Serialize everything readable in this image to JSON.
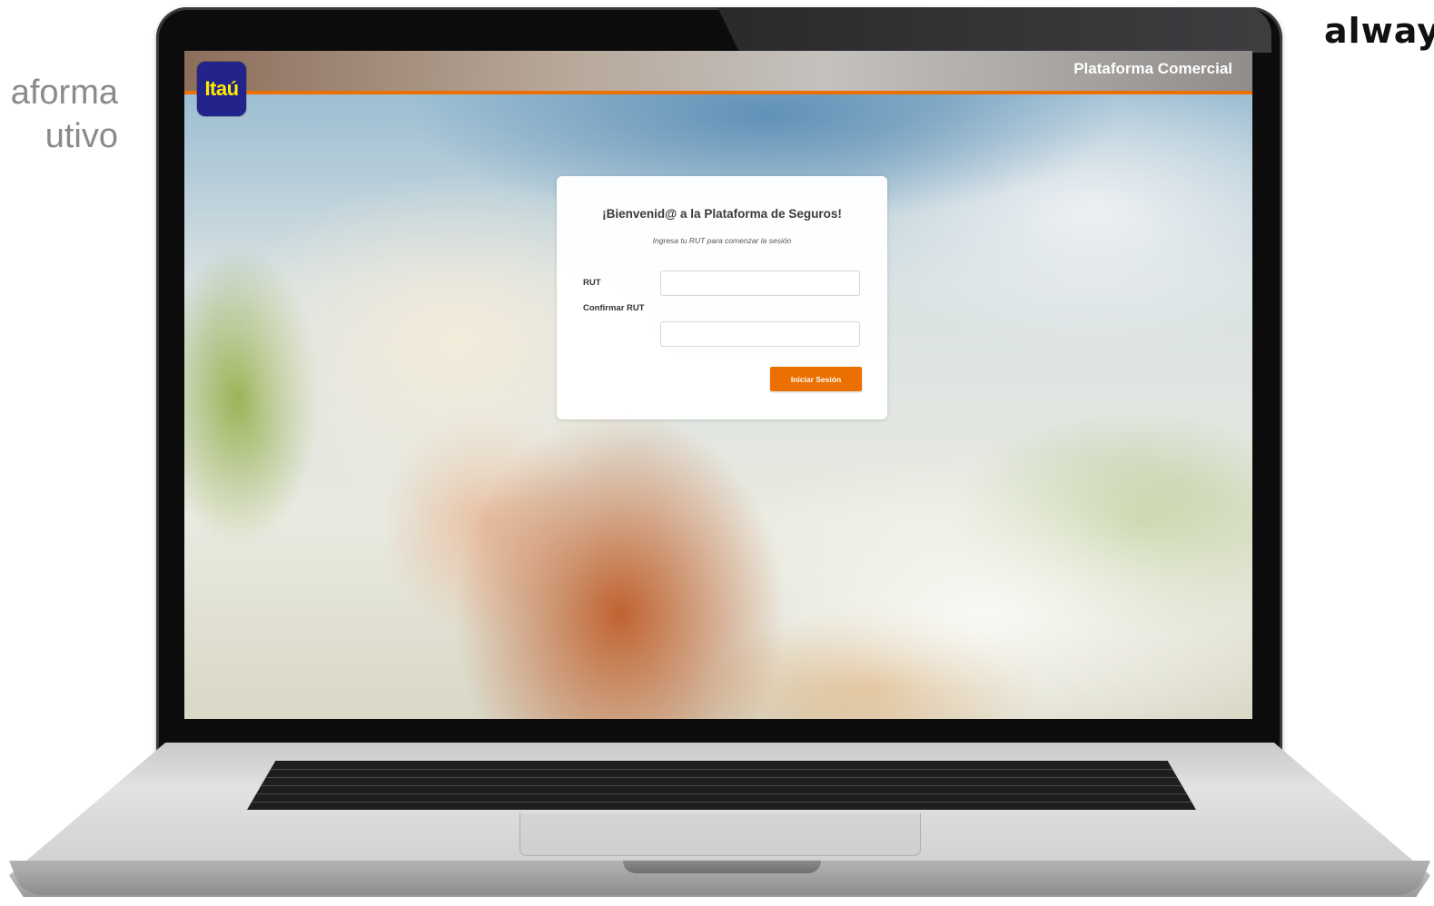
{
  "side_text": {
    "line1": "aforma",
    "line2": "utivo"
  },
  "brand_word": "alway",
  "app": {
    "logo_text": "Itaú",
    "platform_title": "Plataforma Comercial"
  },
  "login": {
    "title": "¡Bienvenid@ a la Plataforma de Seguros!",
    "subtitle": "Ingresa tu RUT para comenzar la sesión",
    "rut_label": "RUT",
    "rut_value": "",
    "confirm_label": "Confirmar RUT",
    "confirm_value": "",
    "submit_label": "Iniciar Sesión"
  },
  "colors": {
    "accent": "#ec7000",
    "logo_bg": "#23238c",
    "logo_text": "#ffec00"
  }
}
